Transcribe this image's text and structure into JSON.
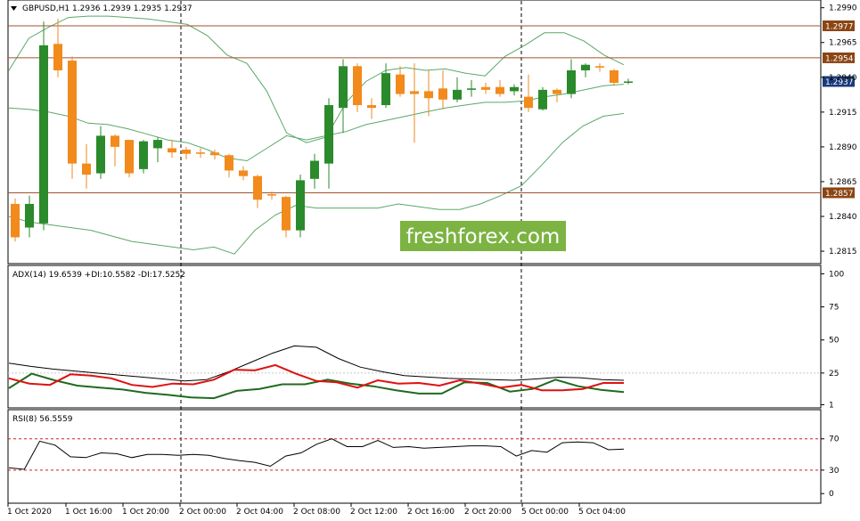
{
  "colors": {
    "background": "#ffffff",
    "bull": "#2b8a2b",
    "bear": "#f28a1c",
    "bollinger": "#5aa86a",
    "level_line": "#a0522d",
    "level_tag": "#8b4513",
    "current_tag": "#1a3a7a",
    "adx": "#000000",
    "plus_di": "#1f6b1f",
    "minus_di": "#e01010",
    "rsi": "#000000",
    "rsi_levels": "#d02020",
    "grid": "#c8c8c8",
    "watermark_bg": "#7cb342"
  },
  "header": {
    "symbol_text": "GBPUSD,H1  1.2936 1.2939 1.2935 1.2937",
    "collapse_icon": "triangle-down-icon"
  },
  "watermark": {
    "text": "freshforex.com"
  },
  "time_labels": [
    "1 Oct 2020",
    "1 Oct 16:00",
    "1 Oct 20:00",
    "2 Oct 00:00",
    "2 Oct 04:00",
    "2 Oct 08:00",
    "2 Oct 12:00",
    "2 Oct 16:00",
    "2 Oct 20:00",
    "5 Oct 00:00",
    "5 Oct 04:00"
  ],
  "chart_data": [
    {
      "type": "candlestick",
      "title": "GBPUSD,H1",
      "ohlc_header": "1.2936 1.2939 1.2935 1.2937",
      "y_ticks": [
        "1.2990",
        "1.2965",
        "1.2940",
        "1.2915",
        "1.2890",
        "1.2865",
        "1.2840",
        "1.2815"
      ],
      "ylim": [
        1.2808,
        1.2993
      ],
      "levels": [
        {
          "label": "1.2977",
          "value": 1.2977
        },
        {
          "label": "1.2954",
          "value": 1.2954
        },
        {
          "label": "1.2857",
          "value": 1.2857
        }
      ],
      "current_price": {
        "label": "1.2937",
        "value": 1.2937
      },
      "candles": [
        {
          "o": 1.2849,
          "h": 1.2853,
          "c": 1.2825,
          "l": 1.2822
        },
        {
          "o": 1.2832,
          "h": 1.2855,
          "c": 1.2849,
          "l": 1.2825
        },
        {
          "o": 1.2835,
          "h": 1.298,
          "c": 1.2963,
          "l": 1.283
        },
        {
          "o": 1.2964,
          "h": 1.2982,
          "c": 1.2945,
          "l": 1.294
        },
        {
          "o": 1.2952,
          "h": 1.2955,
          "c": 1.2878,
          "l": 1.2867
        },
        {
          "o": 1.2878,
          "h": 1.2892,
          "c": 1.287,
          "l": 1.286
        },
        {
          "o": 1.2871,
          "h": 1.2905,
          "c": 1.2898,
          "l": 1.2867
        },
        {
          "o": 1.2898,
          "h": 1.2899,
          "c": 1.289,
          "l": 1.2876
        },
        {
          "o": 1.2895,
          "h": 1.2895,
          "c": 1.2871,
          "l": 1.2868
        },
        {
          "o": 1.2874,
          "h": 1.2895,
          "c": 1.2894,
          "l": 1.2871
        },
        {
          "o": 1.2889,
          "h": 1.2897,
          "c": 1.2895,
          "l": 1.2879
        },
        {
          "o": 1.2889,
          "h": 1.2895,
          "c": 1.2886,
          "l": 1.2882
        },
        {
          "o": 1.2888,
          "h": 1.289,
          "c": 1.2885,
          "l": 1.2881
        },
        {
          "o": 1.2886,
          "h": 1.2889,
          "c": 1.2885,
          "l": 1.2882
        },
        {
          "o": 1.2886,
          "h": 1.2888,
          "c": 1.2884,
          "l": 1.2881
        },
        {
          "o": 1.2884,
          "h": 1.2885,
          "c": 1.2873,
          "l": 1.2868
        },
        {
          "o": 1.2873,
          "h": 1.2876,
          "c": 1.2869,
          "l": 1.2866
        },
        {
          "o": 1.2869,
          "h": 1.287,
          "c": 1.2852,
          "l": 1.2846
        },
        {
          "o": 1.2856,
          "h": 1.2858,
          "c": 1.2855,
          "l": 1.2852
        },
        {
          "o": 1.2854,
          "h": 1.2855,
          "c": 1.283,
          "l": 1.2825
        },
        {
          "o": 1.283,
          "h": 1.287,
          "c": 1.2866,
          "l": 1.2825
        },
        {
          "o": 1.2867,
          "h": 1.2885,
          "c": 1.288,
          "l": 1.286
        },
        {
          "o": 1.2878,
          "h": 1.2925,
          "c": 1.292,
          "l": 1.286
        },
        {
          "o": 1.2918,
          "h": 1.2953,
          "c": 1.2948,
          "l": 1.29
        },
        {
          "o": 1.2948,
          "h": 1.295,
          "c": 1.292,
          "l": 1.2915
        },
        {
          "o": 1.292,
          "h": 1.2925,
          "c": 1.2918,
          "l": 1.291
        },
        {
          "o": 1.292,
          "h": 1.295,
          "c": 1.2943,
          "l": 1.2918
        },
        {
          "o": 1.2942,
          "h": 1.2948,
          "c": 1.2928,
          "l": 1.2926
        },
        {
          "o": 1.293,
          "h": 1.295,
          "c": 1.2928,
          "l": 1.2893
        },
        {
          "o": 1.293,
          "h": 1.2945,
          "c": 1.2925,
          "l": 1.2912
        },
        {
          "o": 1.2932,
          "h": 1.2945,
          "c": 1.2924,
          "l": 1.2917
        },
        {
          "o": 1.2924,
          "h": 1.294,
          "c": 1.2931,
          "l": 1.2922
        },
        {
          "o": 1.2931,
          "h": 1.2938,
          "c": 1.2932,
          "l": 1.2926
        },
        {
          "o": 1.2933,
          "h": 1.2936,
          "c": 1.2931,
          "l": 1.2928
        },
        {
          "o": 1.2933,
          "h": 1.2938,
          "c": 1.2928,
          "l": 1.2926
        },
        {
          "o": 1.293,
          "h": 1.2935,
          "c": 1.2933,
          "l": 1.2927
        },
        {
          "o": 1.2926,
          "h": 1.2942,
          "c": 1.2918,
          "l": 1.2915
        },
        {
          "o": 1.2917,
          "h": 1.2933,
          "c": 1.2931,
          "l": 1.2916
        },
        {
          "o": 1.2931,
          "h": 1.2932,
          "c": 1.2928,
          "l": 1.2922
        },
        {
          "o": 1.2928,
          "h": 1.2953,
          "c": 1.2945,
          "l": 1.2925
        },
        {
          "o": 1.2945,
          "h": 1.295,
          "c": 1.2949,
          "l": 1.294
        },
        {
          "o": 1.2948,
          "h": 1.295,
          "c": 1.2947,
          "l": 1.2944
        },
        {
          "o": 1.2945,
          "h": 1.2946,
          "c": 1.2936,
          "l": 1.2934
        },
        {
          "o": 1.2936,
          "h": 1.2939,
          "c": 1.2937,
          "l": 1.2935
        }
      ],
      "bollinger_upper": [
        1.2945,
        1.2968,
        1.2976,
        1.2983,
        1.2984,
        1.2984,
        1.2983,
        1.2982,
        1.298,
        1.2978,
        1.297,
        1.2956,
        1.295,
        1.293,
        1.29,
        1.2893,
        1.2897,
        1.2922,
        1.2937,
        1.2945,
        1.2947,
        1.2945,
        1.2946,
        1.2943,
        1.2941,
        1.2955,
        1.2963,
        1.2972,
        1.2972,
        1.2966,
        1.2956,
        1.2949
      ],
      "bollinger_middle": [
        1.2918,
        1.2917,
        1.2915,
        1.2912,
        1.2907,
        1.2906,
        1.2903,
        1.2899,
        1.2895,
        1.2893,
        1.2888,
        1.2882,
        1.288,
        1.2889,
        1.2898,
        1.2895,
        1.2898,
        1.2901,
        1.2906,
        1.2909,
        1.2912,
        1.2915,
        1.2918,
        1.292,
        1.2922,
        1.2922,
        1.2923,
        1.2926,
        1.2928,
        1.2931,
        1.2934,
        1.2935
      ],
      "bollinger_lower": [
        1.284,
        1.2836,
        1.2834,
        1.2832,
        1.283,
        1.2826,
        1.2822,
        1.282,
        1.2818,
        1.2816,
        1.2818,
        1.2813,
        1.283,
        1.2841,
        1.2848,
        1.2846,
        1.2846,
        1.2846,
        1.2846,
        1.2849,
        1.2847,
        1.2845,
        1.2845,
        1.2849,
        1.2855,
        1.2862,
        1.2877,
        1.2893,
        1.2905,
        1.2912,
        1.2914
      ]
    },
    {
      "type": "line",
      "title": "ADX(14) 19.6539 +DI:10.5582 -DI:17.5252",
      "y_ticks": [
        "100",
        "75",
        "50",
        "25",
        "1"
      ],
      "ylim": [
        0,
        105
      ],
      "series": [
        {
          "name": "ADX",
          "values": [
            32.5,
            30,
            28,
            26.5,
            25,
            23.5,
            22,
            20.5,
            19,
            20,
            26,
            33,
            40,
            45.5,
            44.5,
            36,
            29.5,
            26,
            23,
            22,
            21,
            20.5,
            20,
            19.5,
            20.5,
            21.8,
            21.5,
            20,
            19.5
          ]
        },
        {
          "name": "+DI",
          "values": [
            13.5,
            24.5,
            19.5,
            15.5,
            14,
            12.5,
            10,
            8.5,
            6.5,
            6,
            11.5,
            13,
            16.5,
            16.5,
            20,
            17,
            15,
            12,
            9.5,
            9.5,
            18,
            17.5,
            11,
            13,
            20,
            15,
            12.3,
            10.6
          ]
        },
        {
          "name": "-DI",
          "values": [
            21,
            17,
            16,
            24,
            23,
            21,
            16,
            14.5,
            17,
            16.5,
            20,
            27.5,
            27,
            31,
            24.5,
            19,
            18,
            14,
            19.5,
            17,
            17.5,
            15.5,
            19.5,
            17,
            14,
            16,
            12,
            12,
            13,
            17.5,
            17.5
          ]
        }
      ]
    },
    {
      "type": "line",
      "title": "RSI(8) 56.5559",
      "y_ticks": [
        "70",
        "30",
        "0"
      ],
      "ylim": [
        -10,
        105
      ],
      "levels": [
        70,
        30
      ],
      "series": [
        {
          "name": "RSI",
          "values": [
            33,
            31,
            67,
            62,
            47,
            46,
            52,
            51,
            46,
            50,
            50,
            49,
            50,
            49,
            45,
            42,
            40,
            35,
            48,
            52,
            63,
            70,
            60,
            60,
            68,
            59,
            60,
            58,
            59,
            60,
            61,
            61,
            60,
            48,
            55,
            53,
            65,
            66,
            65,
            56,
            57
          ]
        }
      ]
    }
  ]
}
